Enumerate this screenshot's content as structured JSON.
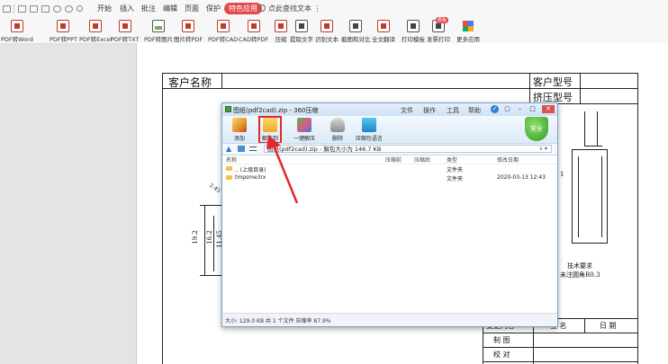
{
  "menubar": {
    "items": [
      "开始",
      "插入",
      "批注",
      "编辑",
      "页面",
      "保护",
      "特色应用"
    ],
    "active_item": "特色应用",
    "search_label": "点此查找文本",
    "accent_color": "#e5484d"
  },
  "ribbon": {
    "tools": [
      "PDF转Word",
      "PDF转PPT",
      "PDF转Excel",
      "PDF转TXT",
      "PDF转图片",
      "图片转PDF",
      "PDF转CAD",
      "CAD转PDF",
      "压缩",
      "提取文字",
      "识别文本",
      "截图和对比",
      "全文翻译",
      "打印模板",
      "发票打印",
      "更多应用"
    ],
    "badge": "限免"
  },
  "drawing": {
    "customer_name_label": "客户名称",
    "customer_model_label": "客户型号",
    "extrusion_model_label": "挤压型号",
    "dim_19_2": "19.2",
    "dim_16_2": "16.2",
    "dim_11_45": "11.45",
    "dim_side": "1",
    "dim_angle": "2.45",
    "tech_req": "技术要求",
    "tech_note": "未注圆角R0.3",
    "change_content_label": "变更内容",
    "signature_label": "签  名",
    "date_label": "日  期",
    "drawn_label": "制  图",
    "checked_label": "校  对"
  },
  "zip_window": {
    "title": "图纸(pdf2cad).zip - 360压缩",
    "menu": [
      "文件",
      "操作",
      "工具",
      "帮助"
    ],
    "toolbar": {
      "add": "添加",
      "extract_to": "解压到",
      "one_click_extract": "一键解压",
      "delete": "删除",
      "extract_here": "压缩包语言"
    },
    "security_label": "安全",
    "address": "图纸(pdf2cad).zip - 解包大小为 146.7 KB",
    "columns": [
      "名称",
      "压缩前",
      "压缩后",
      "类型",
      "修改日期"
    ],
    "rows": [
      {
        "name": ".. (上级目录)",
        "type": "文件夹",
        "date": ""
      },
      {
        "name": "tmpsme3rx",
        "type": "文件夹",
        "date": "2020-03-13 12:43"
      }
    ],
    "status": "大小: 129.0 KB 共 1 个文件 压缩率 87.9%",
    "highlight_color": "#e3282d"
  }
}
